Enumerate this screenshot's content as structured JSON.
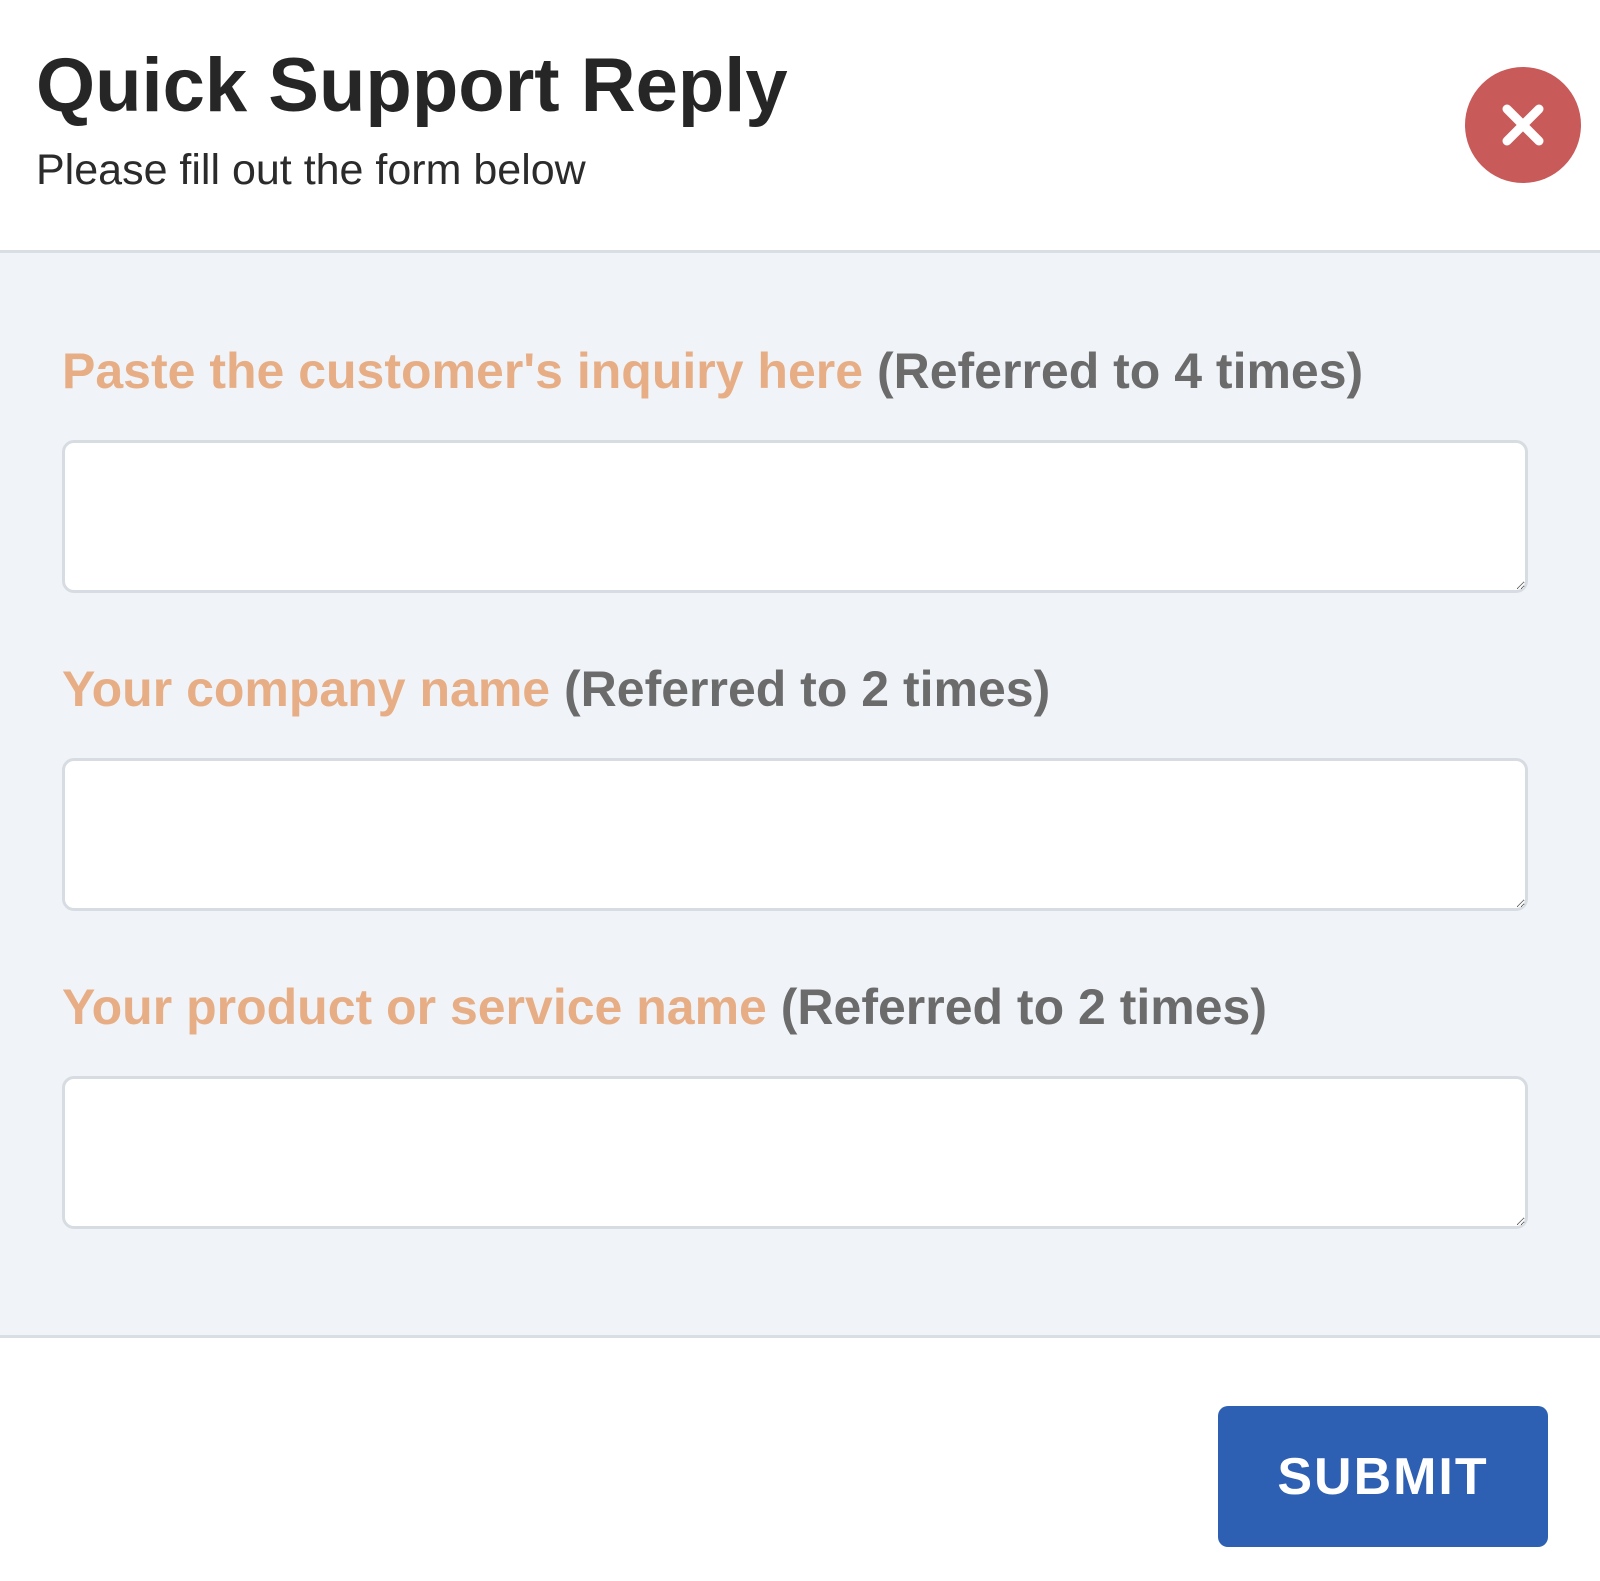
{
  "header": {
    "title": "Quick Support Reply",
    "subtitle": "Please fill out the form below",
    "close_icon": "close-icon"
  },
  "fields": [
    {
      "label": "Paste the customer's inquiry here",
      "count_note": "(Referred to 4 times)",
      "value": "",
      "placeholder": ""
    },
    {
      "label": "Your company name",
      "count_note": "(Referred to 2 times)",
      "value": "",
      "placeholder": ""
    },
    {
      "label": "Your product or service name",
      "count_note": "(Referred to 2 times)",
      "value": "",
      "placeholder": ""
    }
  ],
  "footer": {
    "submit_label": "SUBMIT"
  },
  "colors": {
    "label_accent": "#e7ae86",
    "label_note": "#6b6b6b",
    "close_button": "#c95a5a",
    "submit_button": "#2d5fb3",
    "body_background": "#f0f4f8"
  }
}
